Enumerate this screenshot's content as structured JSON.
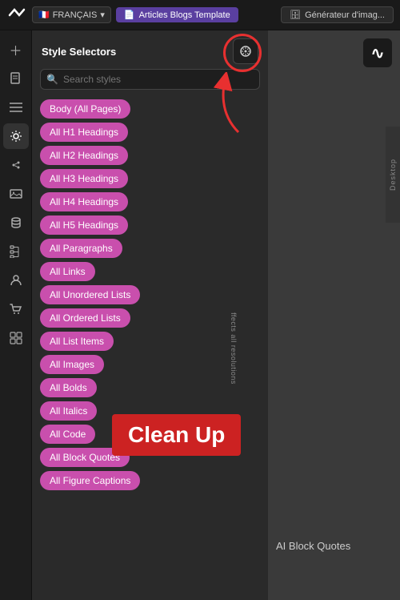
{
  "topbar": {
    "logo_text": "W",
    "lang_flag": "🇫🇷",
    "lang_label": "FRANÇAIS",
    "lang_chevron": "▾",
    "tab_active_icon": "📄",
    "tab_active_label": "Articles Blogs Template",
    "tab_secondary_icon": "🗄",
    "tab_secondary_label": "Générateur d'imag..."
  },
  "sidebar_icons": [
    "＋",
    "□",
    "☰",
    "◆",
    "💧",
    "🖼",
    "⊙",
    "⊕",
    "👤",
    "🛒",
    "⊞"
  ],
  "style_panel": {
    "title": "Style Selectors",
    "search_placeholder": "Search styles",
    "clean_icon": "⚙",
    "selectors": [
      "Body (All Pages)",
      "All H1 Headings",
      "All H2 Headings",
      "All H3 Headings",
      "All H4 Headings",
      "All H5 Headings",
      "All Paragraphs",
      "All Links",
      "All Unordered Lists",
      "All Ordered Lists",
      "All List Items",
      "All Images",
      "All Bolds",
      "All Italics",
      "All Code",
      "All Block Quotes",
      "All Figure Captions"
    ],
    "rotated_text": "ffects all resolutions",
    "desktop_label": "Desktop"
  },
  "annotation": {
    "clean_up_label": "Clean Up"
  },
  "right_area": {
    "logo_symbol": "∿"
  },
  "bottom": {
    "item_label": "AI Block Quotes"
  }
}
